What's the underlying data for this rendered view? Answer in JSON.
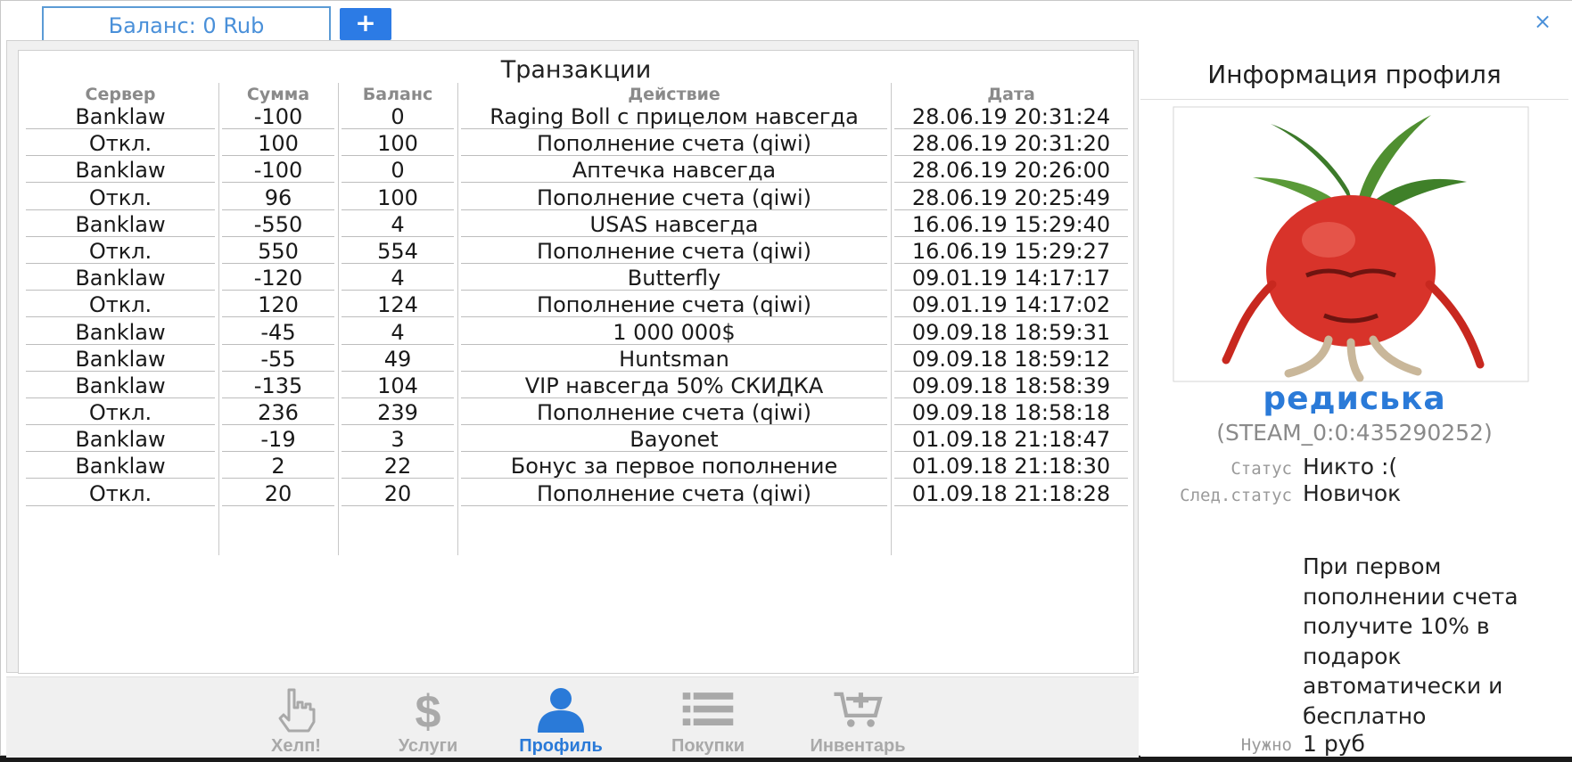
{
  "header": {
    "balance_tab": "Баланс: 0 Rub",
    "plus_label": "+",
    "close_label": "×"
  },
  "transactions": {
    "title": "Транзакции",
    "columns": [
      "Сервер",
      "Сумма",
      "Баланс",
      "Действие",
      "Дата"
    ],
    "rows": [
      [
        "Banklaw",
        "-100",
        "0",
        "Raging Boll с прицелом навсегда",
        "28.06.19 20:31:24"
      ],
      [
        "Откл.",
        "100",
        "100",
        "Пополнение счета (qiwi)",
        "28.06.19 20:31:20"
      ],
      [
        "Banklaw",
        "-100",
        "0",
        "Аптечка навсегда",
        "28.06.19 20:26:00"
      ],
      [
        "Откл.",
        "96",
        "100",
        "Пополнение счета (qiwi)",
        "28.06.19 20:25:49"
      ],
      [
        "Banklaw",
        "-550",
        "4",
        "USAS навсегда",
        "16.06.19 15:29:40"
      ],
      [
        "Откл.",
        "550",
        "554",
        "Пополнение счета (qiwi)",
        "16.06.19 15:29:27"
      ],
      [
        "Banklaw",
        "-120",
        "4",
        "Butterfly",
        "09.01.19 14:17:17"
      ],
      [
        "Откл.",
        "120",
        "124",
        "Пополнение счета (qiwi)",
        "09.01.19 14:17:02"
      ],
      [
        "Banklaw",
        "-45",
        "4",
        "1 000 000$",
        "09.09.18 18:59:31"
      ],
      [
        "Banklaw",
        "-55",
        "49",
        "Huntsman",
        "09.09.18 18:59:12"
      ],
      [
        "Banklaw",
        "-135",
        "104",
        "VIP навсегда 50% СКИДКА",
        "09.09.18 18:58:39"
      ],
      [
        "Откл.",
        "236",
        "239",
        "Пополнение счета (qiwi)",
        "09.09.18 18:58:18"
      ],
      [
        "Banklaw",
        "-19",
        "3",
        "Bayonet",
        "01.09.18 21:18:47"
      ],
      [
        "Banklaw",
        "2",
        "22",
        "Бонус за первое пополнение",
        "01.09.18 21:18:30"
      ],
      [
        "Откл.",
        "20",
        "20",
        "Пополнение счета (qiwi)",
        "01.09.18 21:18:28"
      ]
    ]
  },
  "nav": {
    "items": [
      {
        "label": "Хелп!",
        "icon": "hand-pointer-icon"
      },
      {
        "label": "Услуги",
        "icon": "dollar-icon"
      },
      {
        "label": "Профиль",
        "icon": "user-icon",
        "active": true
      },
      {
        "label": "Покупки",
        "icon": "list-icon"
      },
      {
        "label": "Инвентарь",
        "icon": "cart-plus-icon"
      }
    ]
  },
  "profile": {
    "title": "Информация профиля",
    "username": "редиська",
    "steam_id": "(STEAM_0:0:435290252)",
    "status_label": "Статус",
    "status_value": "Никто :(",
    "next_status_label": "След.статус",
    "next_status_value": "Новичок",
    "bonus_text": "При первом пополнении счета получите 10% в подарок автоматически и бесплатно",
    "need_label": "Нужно",
    "need_value": "1 руб"
  },
  "colors": {
    "accent": "#2a7ad8",
    "tab_border": "#5b9bd5",
    "muted": "#a9a9a9"
  }
}
